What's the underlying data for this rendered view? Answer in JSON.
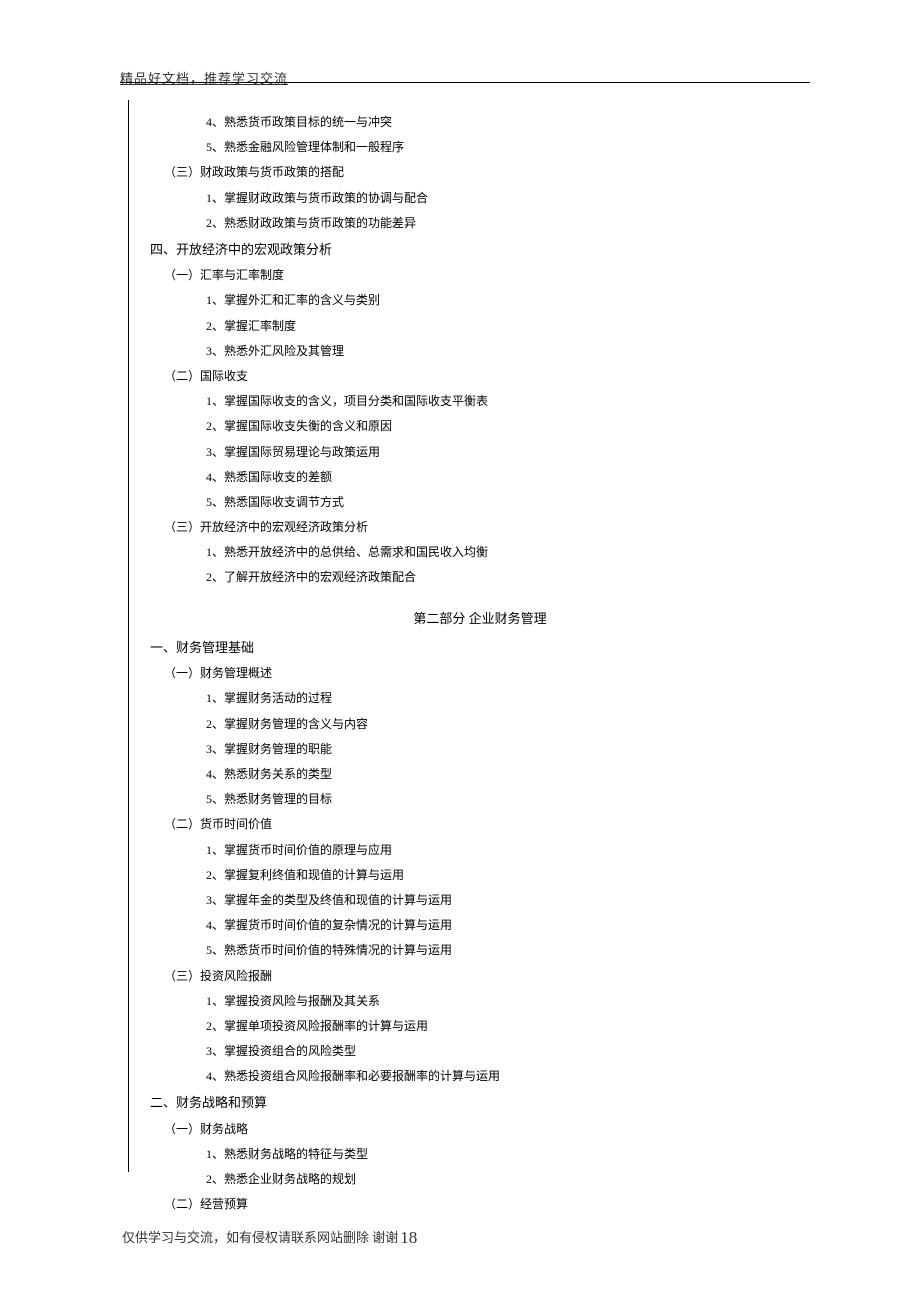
{
  "header": "精品好文档，推荐学习交流",
  "lines": [
    {
      "indent": 2,
      "text": "4、熟悉货币政策目标的统一与冲突"
    },
    {
      "indent": 2,
      "text": "5、熟悉金融风险管理体制和一般程序"
    },
    {
      "indent": 1,
      "text": "（三）财政政策与货币政策的搭配"
    },
    {
      "indent": 2,
      "text": "1、掌握财政政策与货币政策的协调与配合"
    },
    {
      "indent": 2,
      "text": "2、熟悉财政政策与货币政策的功能差异"
    },
    {
      "indent": 0,
      "text": "四、开放经济中的宏观政策分析",
      "heading": true
    },
    {
      "indent": 1,
      "text": "（一）汇率与汇率制度"
    },
    {
      "indent": 2,
      "text": "1、掌握外汇和汇率的含义与类别"
    },
    {
      "indent": 2,
      "text": "2、掌握汇率制度"
    },
    {
      "indent": 2,
      "text": "3、熟悉外汇风险及其管理"
    },
    {
      "indent": 1,
      "text": "（二）国际收支"
    },
    {
      "indent": 2,
      "text": "1、掌握国际收支的含义，项目分类和国际收支平衡表"
    },
    {
      "indent": 2,
      "text": "2、掌握国际收支失衡的含义和原因"
    },
    {
      "indent": 2,
      "text": "3、掌握国际贸易理论与政策运用"
    },
    {
      "indent": 2,
      "text": "4、熟悉国际收支的差额"
    },
    {
      "indent": 2,
      "text": "5、熟悉国际收支调节方式"
    },
    {
      "indent": 1,
      "text": "（三）开放经济中的宏观经济政策分析"
    },
    {
      "indent": 2,
      "text": "1、熟悉开放经济中的总供给、总需求和国民收入均衡"
    },
    {
      "indent": 2,
      "text": "2、了解开放经济中的宏观经济政策配合"
    }
  ],
  "part_title": "第二部分 企业财务管理",
  "lines2": [
    {
      "indent": 0,
      "text": "一、财务管理基础",
      "heading": true
    },
    {
      "indent": 1,
      "text": "（一）财务管理概述"
    },
    {
      "indent": 2,
      "text": "1、掌握财务活动的过程"
    },
    {
      "indent": 2,
      "text": "2、掌握财务管理的含义与内容"
    },
    {
      "indent": 2,
      "text": "3、掌握财务管理的职能"
    },
    {
      "indent": 2,
      "text": "4、熟悉财务关系的类型"
    },
    {
      "indent": 2,
      "text": "5、熟悉财务管理的目标"
    },
    {
      "indent": 1,
      "text": "（二）货币时间价值"
    },
    {
      "indent": 2,
      "text": "1、掌握货币时间价值的原理与应用"
    },
    {
      "indent": 2,
      "text": "2、掌握复利终值和现值的计算与运用"
    },
    {
      "indent": 2,
      "text": "3、掌握年金的类型及终值和现值的计算与运用"
    },
    {
      "indent": 2,
      "text": "4、掌握货币时间价值的复杂情况的计算与运用"
    },
    {
      "indent": 2,
      "text": "5、熟悉货币时间价值的特殊情况的计算与运用"
    },
    {
      "indent": 1,
      "text": "（三）投资风险报酬"
    },
    {
      "indent": 2,
      "text": "1、掌握投资风险与报酬及其关系"
    },
    {
      "indent": 2,
      "text": "2、掌握单项投资风险报酬率的计算与运用"
    },
    {
      "indent": 2,
      "text": "3、掌握投资组合的风险类型"
    },
    {
      "indent": 2,
      "text": "4、熟悉投资组合风险报酬率和必要报酬率的计算与运用"
    },
    {
      "indent": 0,
      "text": "二、财务战略和预算",
      "heading": true
    },
    {
      "indent": 1,
      "text": "（一）财务战略"
    },
    {
      "indent": 2,
      "text": "1、熟悉财务战略的特征与类型"
    },
    {
      "indent": 2,
      "text": "2、熟悉企业财务战略的规划"
    },
    {
      "indent": 1,
      "text": "（二）经营预算"
    }
  ],
  "footer": {
    "text": "仅供学习与交流，如有侵权请联系网站删除 谢谢",
    "page_num": "18"
  }
}
